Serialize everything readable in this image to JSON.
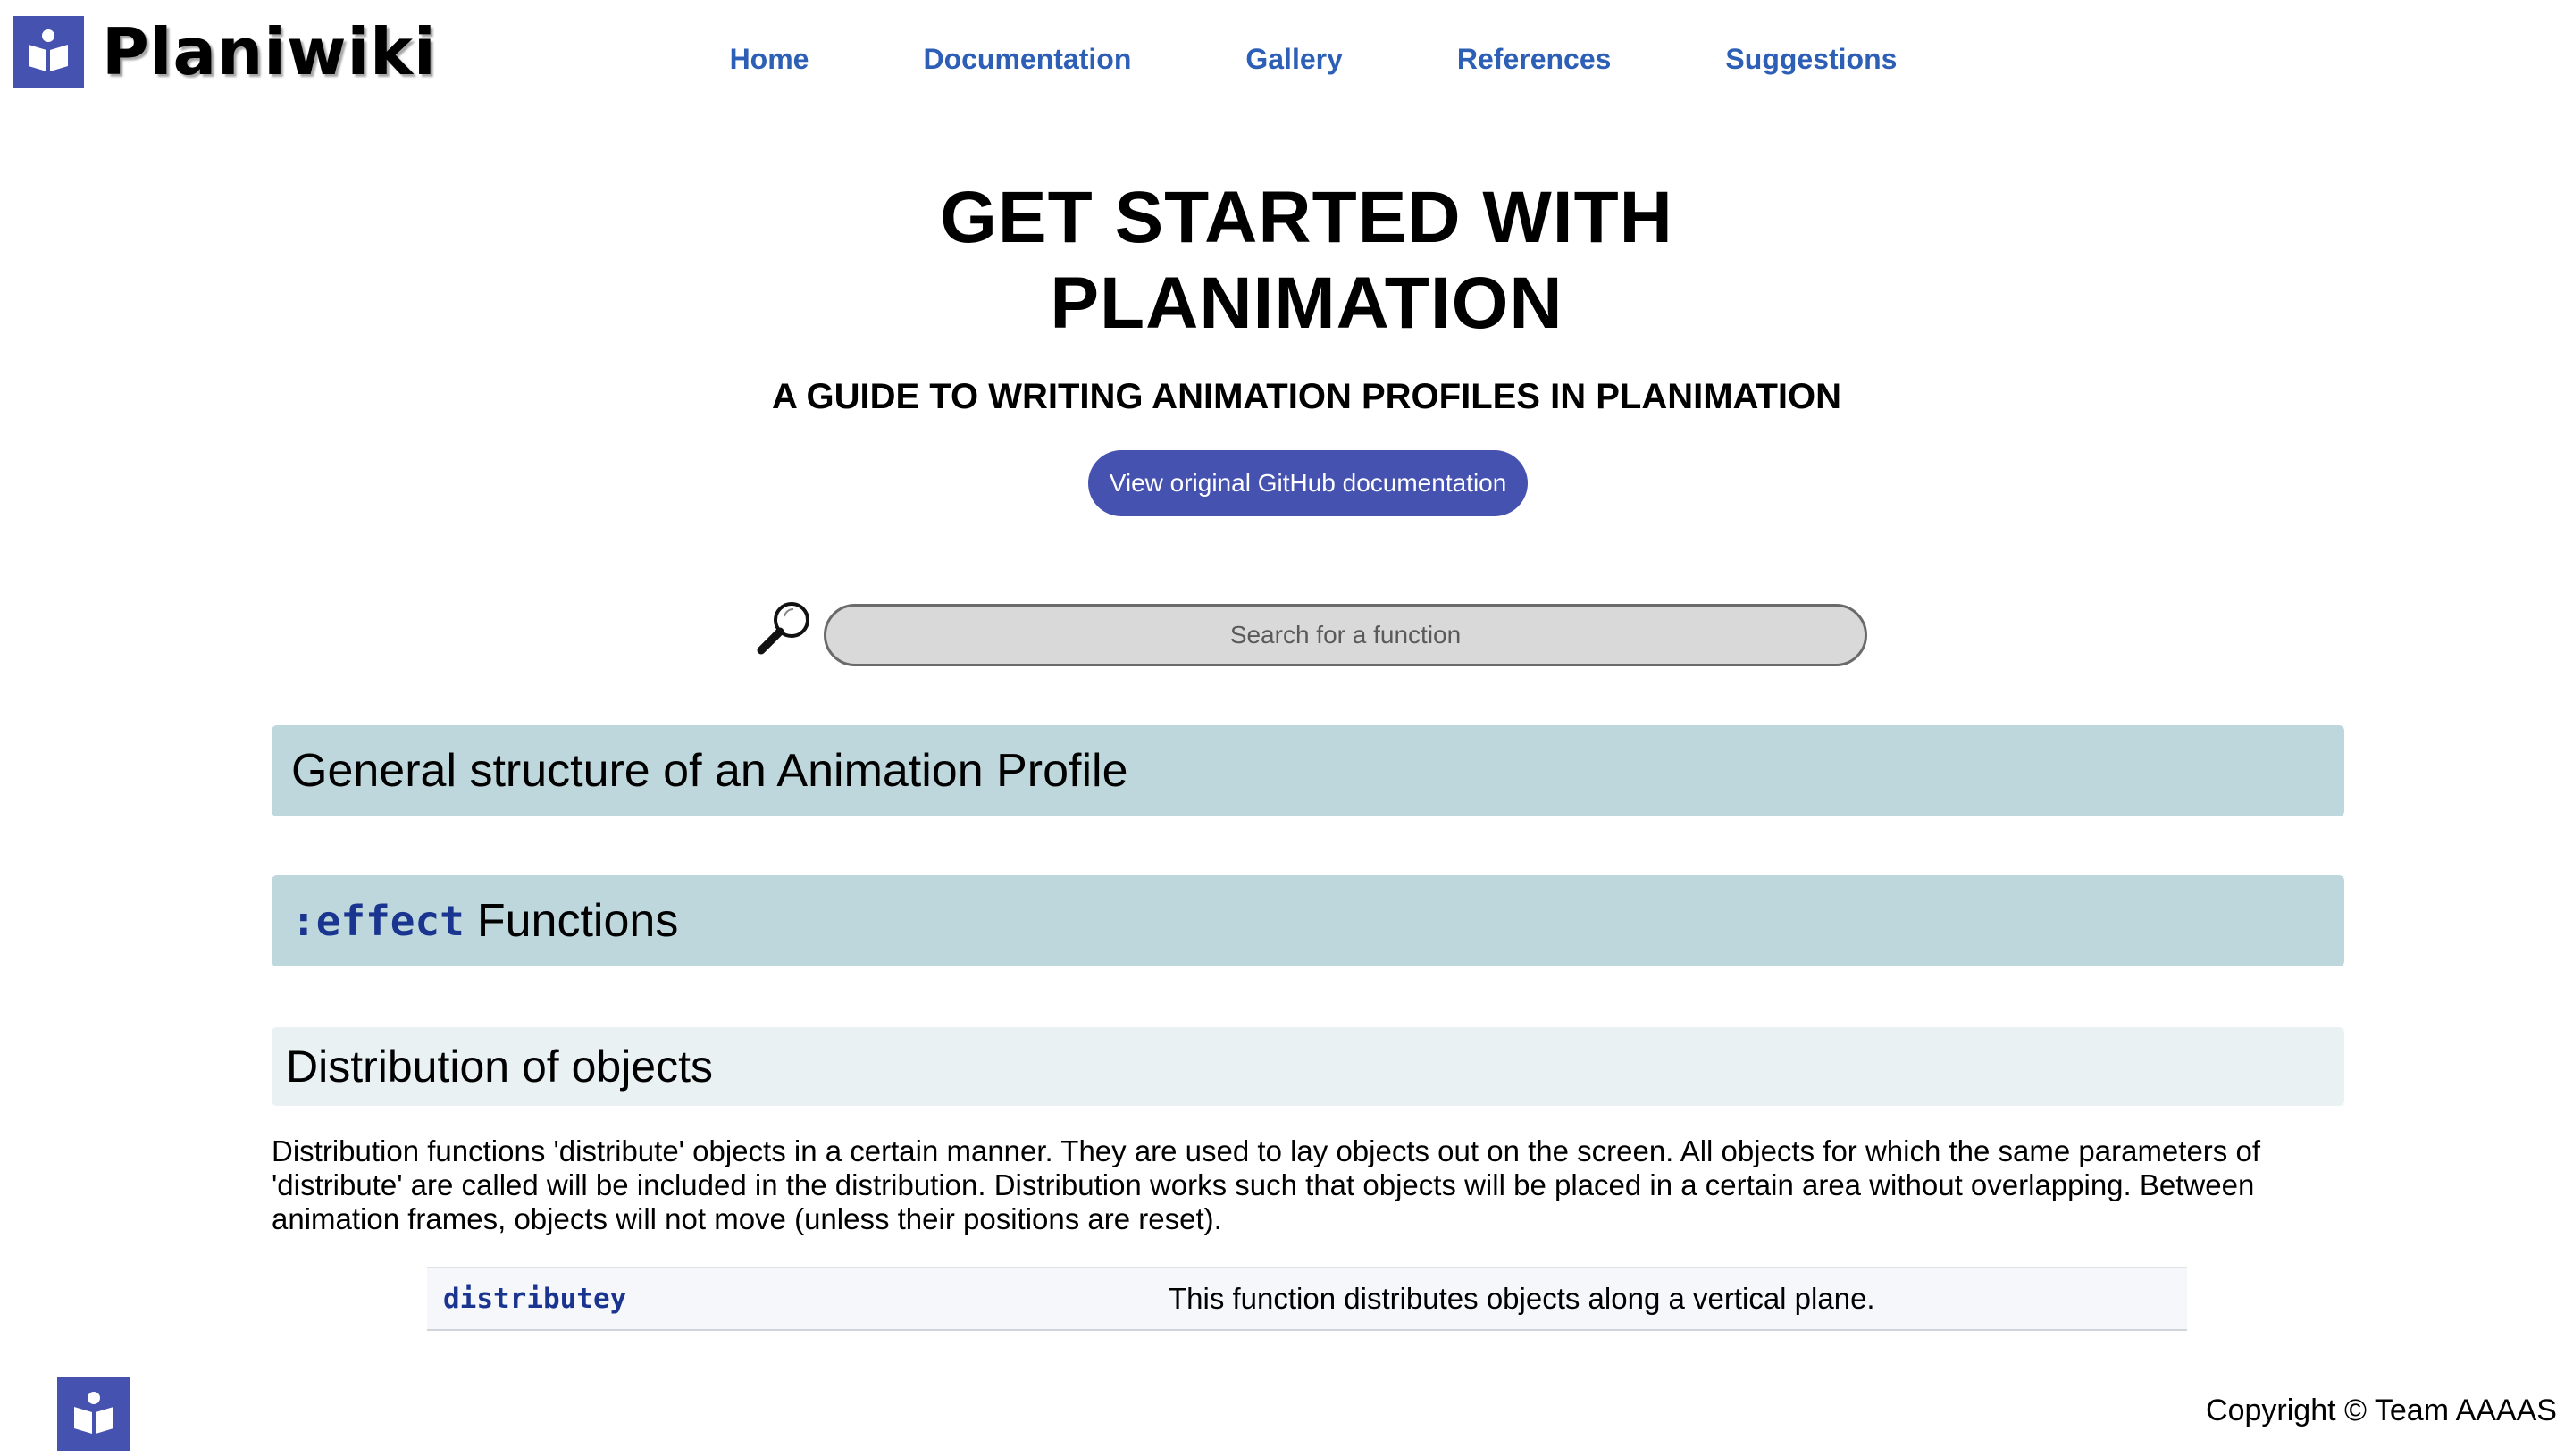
{
  "header": {
    "logo_text": "Planiwiki",
    "logo_icon": "book-reader-icon",
    "nav": [
      "Home",
      "Documentation",
      "Gallery",
      "References",
      "Suggestions"
    ]
  },
  "hero": {
    "title_line1": "GET STARTED WITH",
    "title_line2": "PLANIMATION",
    "subtitle": "A GUIDE TO WRITING ANIMATION PROFILES IN PLANIMATION",
    "github_button": "View original GitHub documentation"
  },
  "search": {
    "placeholder": "Search for a function",
    "icon": "magnifier-icon"
  },
  "sections": {
    "general_structure": "General structure of an Animation Profile",
    "effect_keyword": ":effect",
    "effect_label": "Functions",
    "distribution_heading": "Distribution of objects",
    "distribution_description": "Distribution functions 'distribute' objects in a certain manner. They are used to lay objects out on the screen. All objects for which the same parameters of 'distribute' are called will be included in the distribution. Distribution works such that objects will be placed in a certain area without overlapping. Between animation frames, objects will not move (unless their positions are reset).",
    "functions": [
      {
        "name": "distributey",
        "description": "This function distributes objects along a vertical plane."
      }
    ]
  },
  "footer": {
    "copyright": "Copyright © Team AAAAS"
  },
  "colors": {
    "brand": "#4652b0",
    "nav_link": "#2c5fb5",
    "section_bar": "#bed7dc",
    "sub_bar": "#e9f1f2",
    "code": "#1a3590"
  }
}
